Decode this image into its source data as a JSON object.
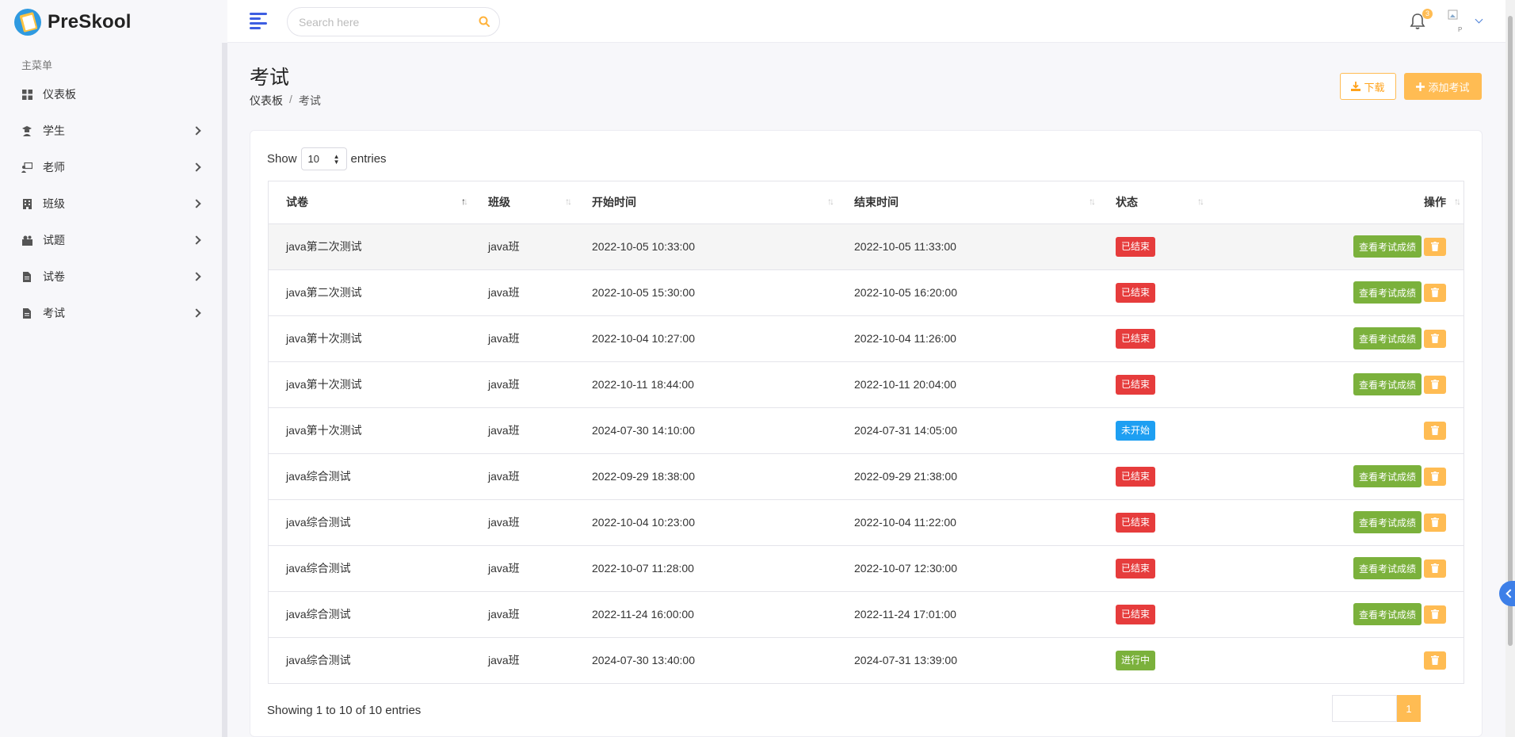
{
  "brand": {
    "name": "PreSkool"
  },
  "sidebar": {
    "menu_title": "主菜单",
    "items": [
      {
        "label": "仪表板",
        "icon": "dashboard-icon",
        "has_children": false
      },
      {
        "label": "学生",
        "icon": "student-icon",
        "has_children": true
      },
      {
        "label": "老师",
        "icon": "teacher-icon",
        "has_children": true
      },
      {
        "label": "班级",
        "icon": "building-icon",
        "has_children": true
      },
      {
        "label": "试题",
        "icon": "questions-icon",
        "has_children": true
      },
      {
        "label": "试卷",
        "icon": "file-icon",
        "has_children": true
      },
      {
        "label": "考试",
        "icon": "file-icon",
        "has_children": true
      }
    ]
  },
  "header": {
    "search_placeholder": "Search here",
    "notification_count": "3"
  },
  "page": {
    "title": "考试",
    "breadcrumb": [
      "仪表板",
      "/",
      "考试"
    ],
    "download_label": "下载",
    "add_label": "添加考试"
  },
  "table": {
    "show_label": "Show",
    "entries_value": "10",
    "entries_label": "entries",
    "columns": [
      "试卷",
      "班级",
      "开始时间",
      "结束时间",
      "状态",
      "操作"
    ],
    "score_button_label": "查看考试成绩",
    "rows": [
      {
        "paper": "java第二次测试",
        "class": "java班",
        "start": "2022-10-05 10:33:00",
        "end": "2022-10-05 11:33:00",
        "status": "已结束",
        "status_type": "ended",
        "has_score": true
      },
      {
        "paper": "java第二次测试",
        "class": "java班",
        "start": "2022-10-05 15:30:00",
        "end": "2022-10-05 16:20:00",
        "status": "已结束",
        "status_type": "ended",
        "has_score": true
      },
      {
        "paper": "java第十次测试",
        "class": "java班",
        "start": "2022-10-04 10:27:00",
        "end": "2022-10-04 11:26:00",
        "status": "已结束",
        "status_type": "ended",
        "has_score": true
      },
      {
        "paper": "java第十次测试",
        "class": "java班",
        "start": "2022-10-11 18:44:00",
        "end": "2022-10-11 20:04:00",
        "status": "已结束",
        "status_type": "ended",
        "has_score": true
      },
      {
        "paper": "java第十次测试",
        "class": "java班",
        "start": "2024-07-30 14:10:00",
        "end": "2024-07-31 14:05:00",
        "status": "未开始",
        "status_type": "not-started",
        "has_score": false
      },
      {
        "paper": "java综合测试",
        "class": "java班",
        "start": "2022-09-29 18:38:00",
        "end": "2022-09-29 21:38:00",
        "status": "已结束",
        "status_type": "ended",
        "has_score": true
      },
      {
        "paper": "java综合测试",
        "class": "java班",
        "start": "2022-10-04 10:23:00",
        "end": "2022-10-04 11:22:00",
        "status": "已结束",
        "status_type": "ended",
        "has_score": true
      },
      {
        "paper": "java综合测试",
        "class": "java班",
        "start": "2022-10-07 11:28:00",
        "end": "2022-10-07 12:30:00",
        "status": "已结束",
        "status_type": "ended",
        "has_score": true
      },
      {
        "paper": "java综合测试",
        "class": "java班",
        "start": "2022-11-24 16:00:00",
        "end": "2022-11-24 17:01:00",
        "status": "已结束",
        "status_type": "ended",
        "has_score": true
      },
      {
        "paper": "java综合测试",
        "class": "java班",
        "start": "2024-07-30 13:40:00",
        "end": "2024-07-31 13:39:00",
        "status": "进行中",
        "status_type": "ongoing",
        "has_score": false
      }
    ],
    "footer_info": "Showing 1 to 10 of 10 entries",
    "pagination": {
      "current": "1"
    }
  },
  "colors": {
    "accent_yellow": "#ffbc53",
    "accent_blue": "#3d5ee1",
    "ended_red": "#e63c3c",
    "not_started_blue": "#1e9ff2",
    "ongoing_green": "#7bb13c"
  }
}
